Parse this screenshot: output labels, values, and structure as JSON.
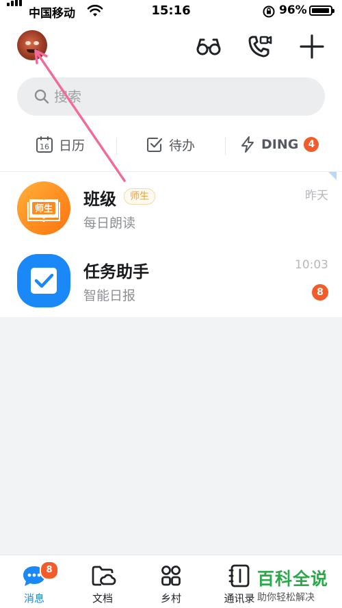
{
  "status_bar": {
    "carrier": "中国移动",
    "time": "15:16",
    "battery_percent": "96%",
    "battery_level": 0.96
  },
  "header": {
    "icons": [
      "glasses-icon",
      "phone-video-icon",
      "plus-icon"
    ]
  },
  "search": {
    "placeholder": "搜索"
  },
  "quick_actions": [
    {
      "label": "日历",
      "icon": "calendar-icon",
      "icon_text": "16"
    },
    {
      "label": "待办",
      "icon": "checkbox-icon"
    },
    {
      "label": "DING",
      "icon": "lightning-icon",
      "badge": "4"
    }
  ],
  "conversations": [
    {
      "title": "班级",
      "tag": "师生",
      "subtitle": "每日朗读",
      "time": "昨天",
      "icon_text": "师生"
    },
    {
      "title": "任务助手",
      "subtitle": "智能日报",
      "time": "10:03",
      "unread": "8"
    }
  ],
  "bottom_nav": [
    {
      "label": "消息",
      "badge": "8",
      "active": true
    },
    {
      "label": "文档"
    },
    {
      "label": "乡村"
    },
    {
      "label": "通讯录"
    }
  ],
  "watermark": {
    "main": "百科全说",
    "sub": "助你轻松解决"
  },
  "colors": {
    "accent": "#1a88f6",
    "badge": "#f25c2a",
    "pointer": "#f06b9a"
  }
}
